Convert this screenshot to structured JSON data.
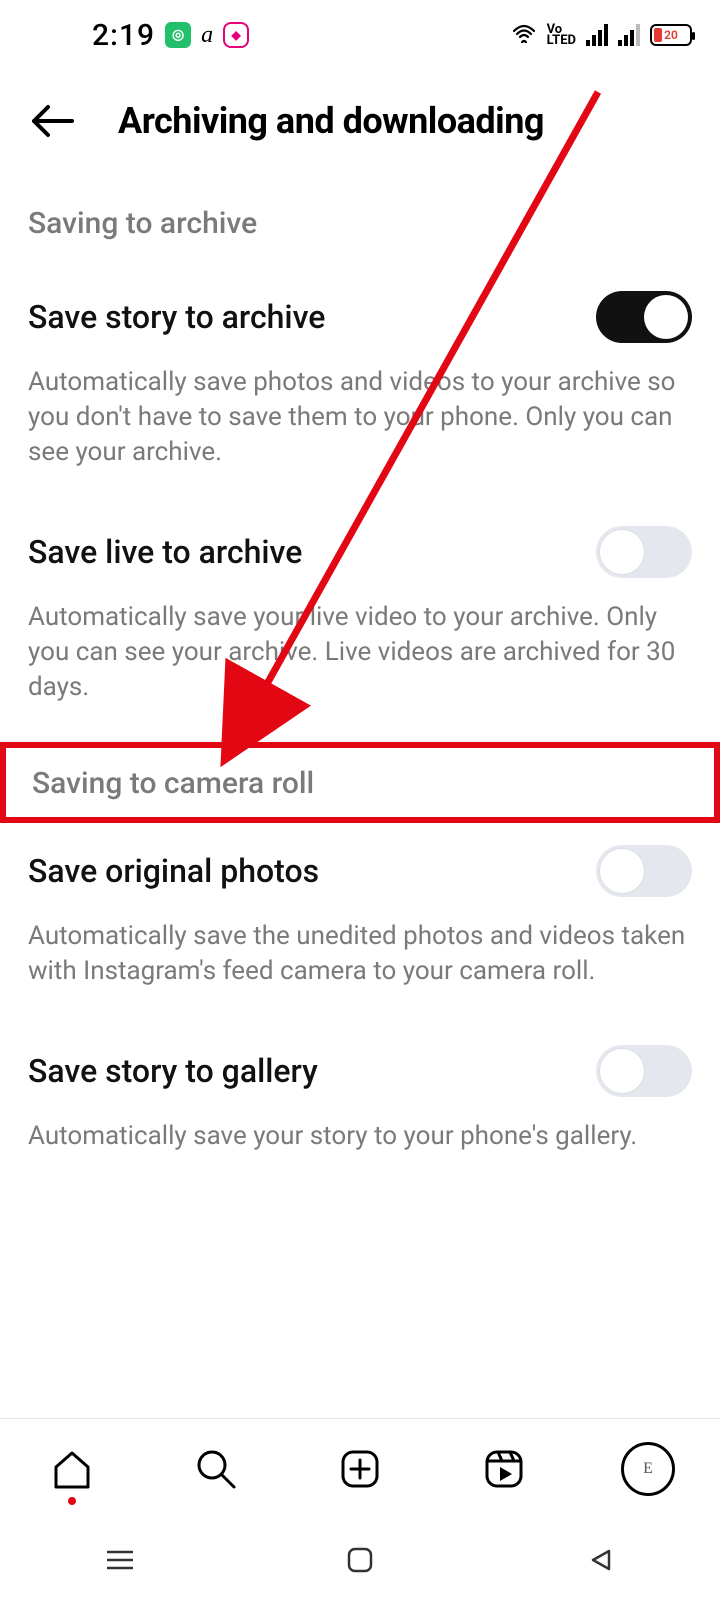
{
  "status": {
    "time": "2:19",
    "battery_pct": "20",
    "volte": "Vo\nLTED"
  },
  "header": {
    "title": "Archiving and downloading"
  },
  "sections": {
    "archive_title": "Saving to archive",
    "camera_roll_title": "Saving to camera roll"
  },
  "settings": {
    "save_story_archive": {
      "label": "Save story to archive",
      "desc": "Automatically save photos and videos to your archive so you don't have to save them to your phone. Only you can see your archive.",
      "on": true
    },
    "save_live_archive": {
      "label": "Save live to archive",
      "desc": "Automatically save your live video to your archive. Only you can see your archive. Live videos are archived for 30 days.",
      "on": false
    },
    "save_original_photos": {
      "label": "Save original photos",
      "desc": "Automatically save the unedited photos and videos taken with Instagram's feed camera to your camera roll.",
      "on": false
    },
    "save_story_gallery": {
      "label": "Save story to gallery",
      "desc": "Automatically save your story to your phone's gallery.",
      "on": false
    }
  }
}
